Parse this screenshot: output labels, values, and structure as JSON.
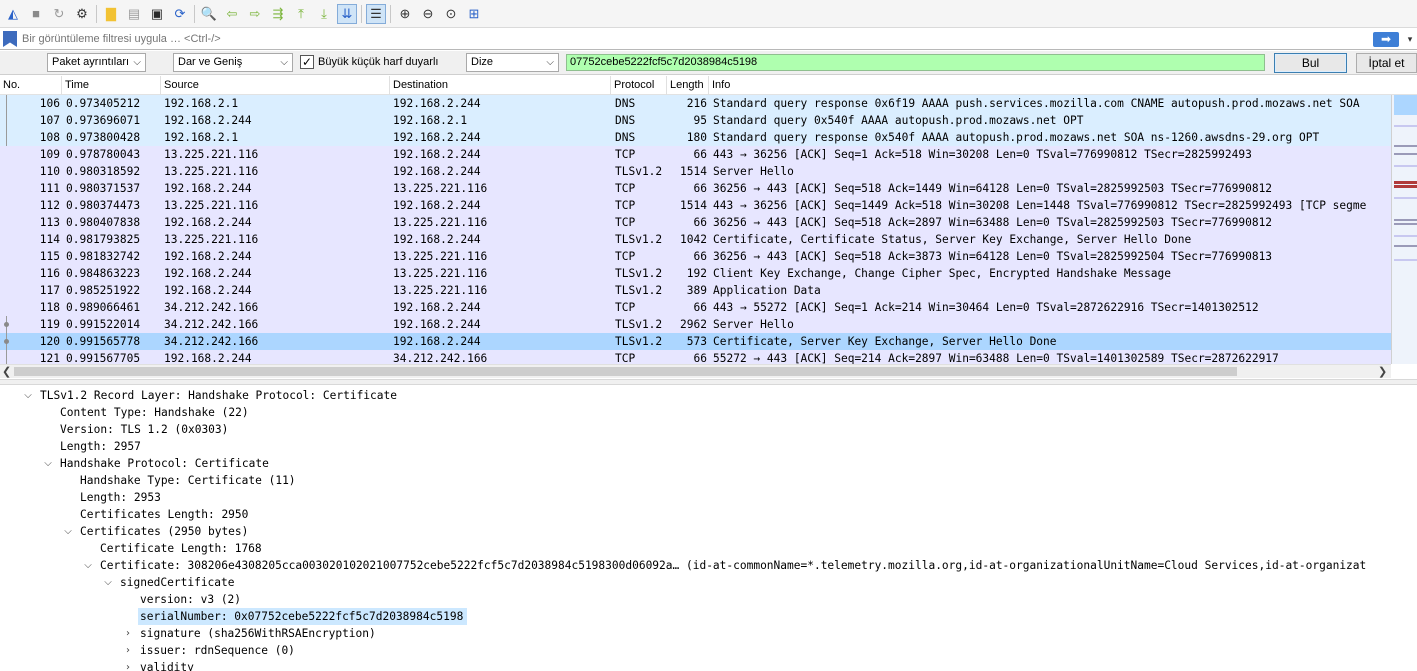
{
  "toolbar": {
    "buttons": [
      {
        "name": "start-capture-icon",
        "glyph": "◭",
        "color": "#2a62c9"
      },
      {
        "name": "stop-capture-icon",
        "glyph": "■",
        "color": "#8a8a8a"
      },
      {
        "name": "restart-capture-icon",
        "glyph": "↻",
        "color": "#9a9a9a"
      },
      {
        "name": "capture-options-icon",
        "glyph": "⚙",
        "color": "#333333"
      },
      {
        "sep": true
      },
      {
        "name": "open-file-icon",
        "glyph": "▇",
        "color": "#f2c233"
      },
      {
        "name": "save-file-icon",
        "glyph": "▤",
        "color": "#9c9c9c"
      },
      {
        "name": "close-file-icon",
        "glyph": "▣",
        "color": "#2a2a2a"
      },
      {
        "name": "reload-file-icon",
        "glyph": "⟳",
        "color": "#2a62c9"
      },
      {
        "sep": true
      },
      {
        "name": "find-packet-icon",
        "glyph": "🔍",
        "color": "#333333"
      },
      {
        "name": "go-back-icon",
        "glyph": "⇦",
        "color": "#7bb53b"
      },
      {
        "name": "go-forward-icon",
        "glyph": "⇨",
        "color": "#7bb53b"
      },
      {
        "name": "go-to-packet-icon",
        "glyph": "⇶",
        "color": "#7bb53b"
      },
      {
        "name": "first-packet-icon",
        "glyph": "⤒",
        "color": "#7bb53b"
      },
      {
        "name": "last-packet-icon",
        "glyph": "⤓",
        "color": "#7bb53b"
      },
      {
        "name": "auto-scroll-icon",
        "glyph": "⇊",
        "color": "#2a62c9",
        "active": true
      },
      {
        "sep": true
      },
      {
        "name": "colorize-icon",
        "glyph": "☰",
        "color": "#333333",
        "active": true
      },
      {
        "sep": true
      },
      {
        "name": "zoom-in-icon",
        "glyph": "⊕",
        "color": "#333333"
      },
      {
        "name": "zoom-out-icon",
        "glyph": "⊖",
        "color": "#333333"
      },
      {
        "name": "normal-size-icon",
        "glyph": "⊙",
        "color": "#333333"
      },
      {
        "name": "resize-columns-icon",
        "glyph": "⊞",
        "color": "#2a62c9"
      }
    ]
  },
  "filter": {
    "placeholder": "Bir görüntüleme filtresi uygula … <Ctrl-/>",
    "apply_glyph": "➡",
    "dropdown_glyph": "▾"
  },
  "find": {
    "search_in": "Paket ayrıntıları",
    "char_width": "Dar ve Geniş",
    "case_sensitive_label": "Büyük küçük harf duyarlı",
    "case_sensitive_checked": "✓",
    "search_type": "Dize",
    "search_value": "07752cebe5222fcf5c7d2038984c5198",
    "find_label": "Bul",
    "cancel_label": "İptal et",
    "dropdown_glyph": "⌵"
  },
  "packet_list": {
    "columns": [
      "No.",
      "Time",
      "Source",
      "Destination",
      "Protocol",
      "Length",
      "Info"
    ],
    "rows": [
      {
        "no": "106",
        "time": "0.973405212",
        "src": "192.168.2.1",
        "dst": "192.168.2.244",
        "proto": "DNS",
        "len": "216",
        "info": "Standard query response 0x6f19 AAAA push.services.mozilla.com CNAME autopush.prod.mozaws.net SOA",
        "kind": "dns"
      },
      {
        "no": "107",
        "time": "0.973696071",
        "src": "192.168.2.244",
        "dst": "192.168.2.1",
        "proto": "DNS",
        "len": "95",
        "info": "Standard query 0x540f AAAA autopush.prod.mozaws.net OPT",
        "kind": "dns"
      },
      {
        "no": "108",
        "time": "0.973800428",
        "src": "192.168.2.1",
        "dst": "192.168.2.244",
        "proto": "DNS",
        "len": "180",
        "info": "Standard query response 0x540f AAAA autopush.prod.mozaws.net SOA ns-1260.awsdns-29.org OPT",
        "kind": "dns"
      },
      {
        "no": "109",
        "time": "0.978780043",
        "src": "13.225.221.116",
        "dst": "192.168.2.244",
        "proto": "TCP",
        "len": "66",
        "info": "443 → 36256 [ACK] Seq=1 Ack=518 Win=30208 Len=0 TSval=776990812 TSecr=2825992493",
        "kind": "tcp"
      },
      {
        "no": "110",
        "time": "0.980318592",
        "src": "13.225.221.116",
        "dst": "192.168.2.244",
        "proto": "TLSv1.2",
        "len": "1514",
        "info": "Server Hello",
        "kind": "tcp"
      },
      {
        "no": "111",
        "time": "0.980371537",
        "src": "192.168.2.244",
        "dst": "13.225.221.116",
        "proto": "TCP",
        "len": "66",
        "info": "36256 → 443 [ACK] Seq=518 Ack=1449 Win=64128 Len=0 TSval=2825992503 TSecr=776990812",
        "kind": "tcp"
      },
      {
        "no": "112",
        "time": "0.980374473",
        "src": "13.225.221.116",
        "dst": "192.168.2.244",
        "proto": "TCP",
        "len": "1514",
        "info": "443 → 36256 [ACK] Seq=1449 Ack=518 Win=30208 Len=1448 TSval=776990812 TSecr=2825992493 [TCP segme",
        "kind": "tcp"
      },
      {
        "no": "113",
        "time": "0.980407838",
        "src": "192.168.2.244",
        "dst": "13.225.221.116",
        "proto": "TCP",
        "len": "66",
        "info": "36256 → 443 [ACK] Seq=518 Ack=2897 Win=63488 Len=0 TSval=2825992503 TSecr=776990812",
        "kind": "tcp"
      },
      {
        "no": "114",
        "time": "0.981793825",
        "src": "13.225.221.116",
        "dst": "192.168.2.244",
        "proto": "TLSv1.2",
        "len": "1042",
        "info": "Certificate, Certificate Status, Server Key Exchange, Server Hello Done",
        "kind": "tcp"
      },
      {
        "no": "115",
        "time": "0.981832742",
        "src": "192.168.2.244",
        "dst": "13.225.221.116",
        "proto": "TCP",
        "len": "66",
        "info": "36256 → 443 [ACK] Seq=518 Ack=3873 Win=64128 Len=0 TSval=2825992504 TSecr=776990813",
        "kind": "tcp"
      },
      {
        "no": "116",
        "time": "0.984863223",
        "src": "192.168.2.244",
        "dst": "13.225.221.116",
        "proto": "TLSv1.2",
        "len": "192",
        "info": "Client Key Exchange, Change Cipher Spec, Encrypted Handshake Message",
        "kind": "tcp"
      },
      {
        "no": "117",
        "time": "0.985251922",
        "src": "192.168.2.244",
        "dst": "13.225.221.116",
        "proto": "TLSv1.2",
        "len": "389",
        "info": "Application Data",
        "kind": "tcp"
      },
      {
        "no": "118",
        "time": "0.989066461",
        "src": "34.212.242.166",
        "dst": "192.168.2.244",
        "proto": "TCP",
        "len": "66",
        "info": "443 → 55272 [ACK] Seq=1 Ack=214 Win=30464 Len=0 TSval=2872622916 TSecr=1401302512",
        "kind": "tcp"
      },
      {
        "no": "119",
        "time": "0.991522014",
        "src": "34.212.242.166",
        "dst": "192.168.2.244",
        "proto": "TLSv1.2",
        "len": "2962",
        "info": "Server Hello",
        "kind": "tcp"
      },
      {
        "no": "120",
        "time": "0.991565778",
        "src": "34.212.242.166",
        "dst": "192.168.2.244",
        "proto": "TLSv1.2",
        "len": "573",
        "info": "Certificate, Server Key Exchange, Server Hello Done",
        "kind": "sel"
      },
      {
        "no": "121",
        "time": "0.991567705",
        "src": "192.168.2.244",
        "dst": "34.212.242.166",
        "proto": "TCP",
        "len": "66",
        "info": "55272 → 443 [ACK] Seq=214 Ack=2897 Win=63488 Len=0 TSval=1401302589 TSecr=2872622917",
        "kind": "tcp"
      }
    ]
  },
  "details": {
    "rows": [
      {
        "text": "TLSv1.2 Record Layer: Handshake Protocol: Certificate",
        "depth": 0,
        "toggle": "open"
      },
      {
        "text": "Content Type: Handshake (22)",
        "depth": 1,
        "toggle": "none"
      },
      {
        "text": "Version: TLS 1.2 (0x0303)",
        "depth": 1,
        "toggle": "none"
      },
      {
        "text": "Length: 2957",
        "depth": 1,
        "toggle": "none"
      },
      {
        "text": "Handshake Protocol: Certificate",
        "depth": 1,
        "toggle": "open"
      },
      {
        "text": "Handshake Type: Certificate (11)",
        "depth": 2,
        "toggle": "none"
      },
      {
        "text": "Length: 2953",
        "depth": 2,
        "toggle": "none"
      },
      {
        "text": "Certificates Length: 2950",
        "depth": 2,
        "toggle": "none"
      },
      {
        "text": "Certificates (2950 bytes)",
        "depth": 2,
        "toggle": "open"
      },
      {
        "text": "Certificate Length: 1768",
        "depth": 3,
        "toggle": "none"
      },
      {
        "text": "Certificate: 308206e4308205cca003020102021007752cebe5222fcf5c7d2038984c5198300d06092a… (id-at-commonName=*.telemetry.mozilla.org,id-at-organizationalUnitName=Cloud Services,id-at-organizat",
        "depth": 3,
        "toggle": "open"
      },
      {
        "text": "signedCertificate",
        "depth": 4,
        "toggle": "open"
      },
      {
        "text": "version: v3 (2)",
        "depth": 5,
        "toggle": "none"
      },
      {
        "text": "serialNumber: 0x07752cebe5222fcf5c7d2038984c5198",
        "depth": 5,
        "toggle": "none",
        "highlight": true
      },
      {
        "text": "signature (sha256WithRSAEncryption)",
        "depth": 5,
        "toggle": "closed"
      },
      {
        "text": "issuer: rdnSequence (0)",
        "depth": 5,
        "toggle": "closed"
      },
      {
        "text": "validity",
        "depth": 5,
        "toggle": "closed"
      }
    ]
  },
  "colors": {
    "dns_row": "#daeeff",
    "tcp_row": "#e7e6ff",
    "selected_row": "#acd6ff",
    "search_field": "#afffaf"
  }
}
